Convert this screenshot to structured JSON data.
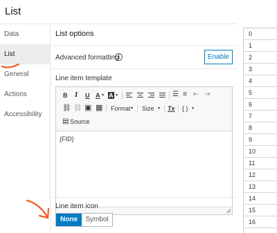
{
  "title": "List",
  "nav": {
    "items": [
      {
        "label": "Data"
      },
      {
        "label": "List"
      },
      {
        "label": "General"
      },
      {
        "label": "Actions"
      },
      {
        "label": "Accessibility"
      }
    ],
    "active": "List"
  },
  "panel": {
    "title": "List options",
    "advanced_formatting_label": "Advanced formatting",
    "enable_label": "Enable",
    "template_label": "Line item template",
    "toolbar": {
      "bold": "B",
      "italic": "I",
      "underline": "U",
      "font_color": "A",
      "highlight": "A",
      "format": "Format",
      "size": "Size",
      "clear_format": "Tx",
      "code": "{ }",
      "source": "Source"
    },
    "editor_content": "{FID}",
    "line_item_icon_label": "Line item icon",
    "icon_options": [
      "None",
      "Symbol"
    ],
    "selected_icon_option": "None"
  },
  "right_list": [
    "0",
    "1",
    "2",
    "3",
    "4",
    "5",
    "6",
    "7",
    "8",
    "9",
    "10",
    "11",
    "12",
    "13",
    "14",
    "15",
    "16"
  ],
  "colors": {
    "accent": "#007ac2",
    "annotation": "#f05a1e",
    "nav_active_bg": "#ececec"
  }
}
